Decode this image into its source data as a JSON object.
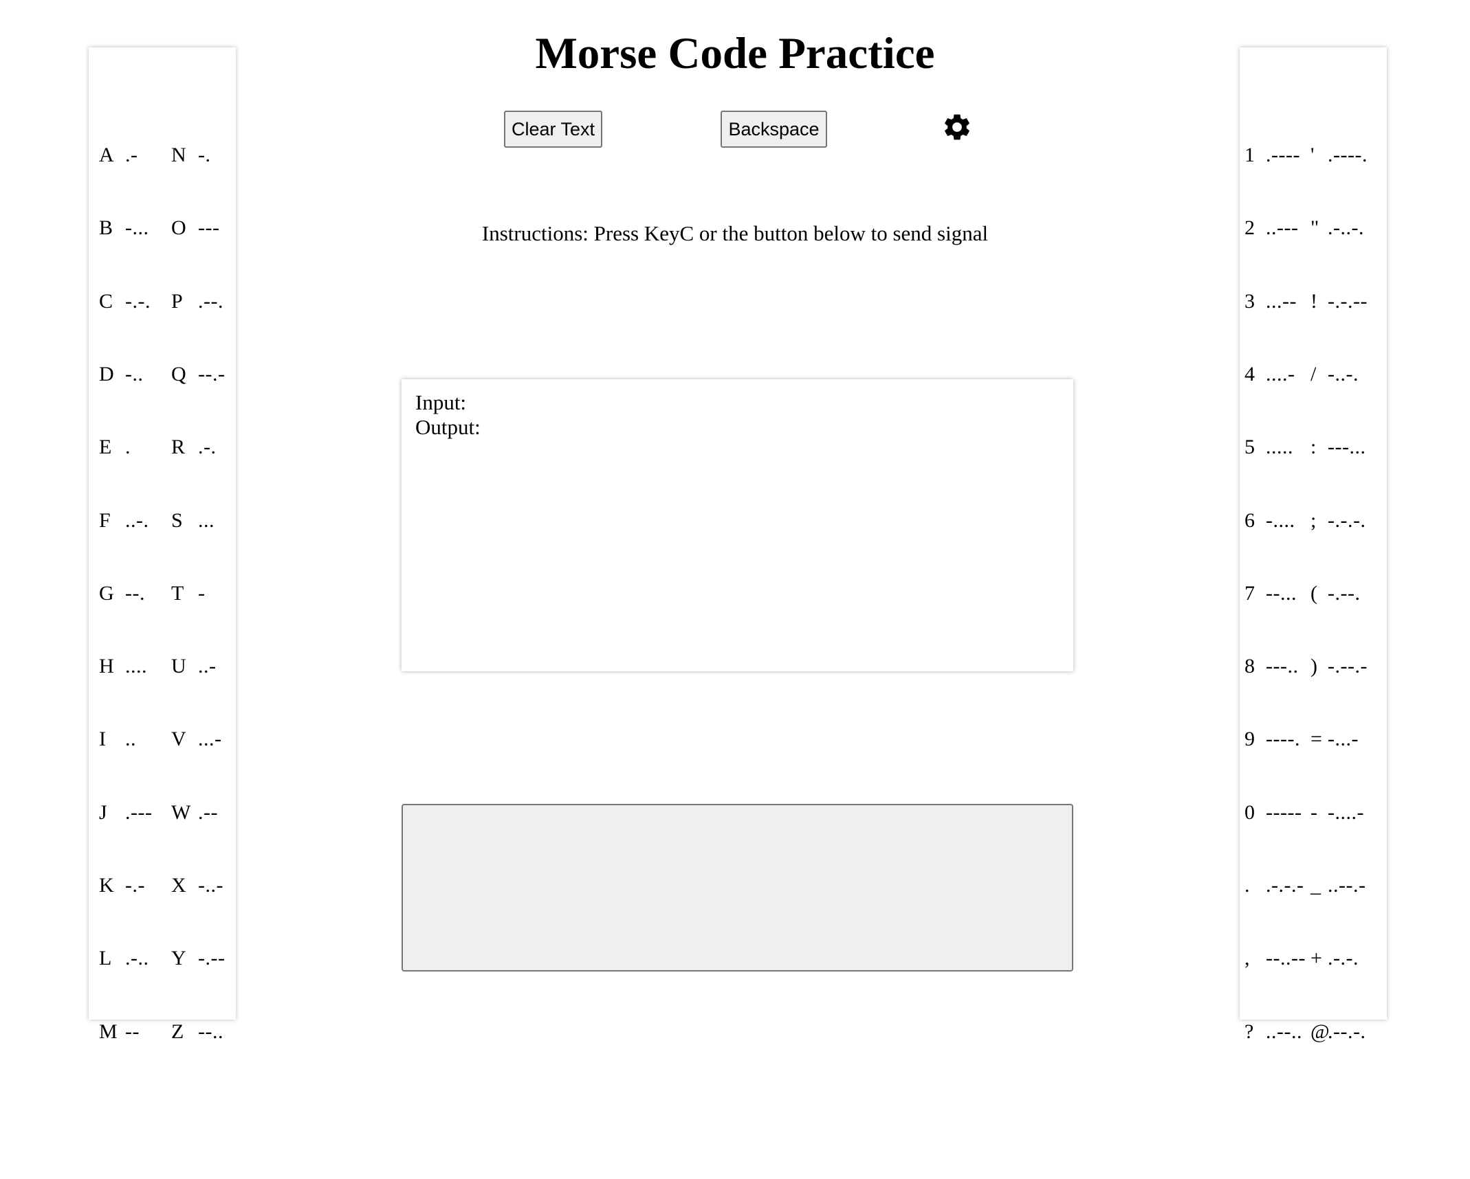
{
  "title": "Morse Code Practice",
  "toolbar": {
    "clear_label": "Clear Text",
    "backspace_label": "Backspace",
    "settings_icon": "gear-icon"
  },
  "instructions": "Instructions: Press KeyC or the button below to send signal",
  "output_box": {
    "input_label": "Input:",
    "input_value": "",
    "output_label": "Output:",
    "output_value": ""
  },
  "signal_button": {
    "label": ""
  },
  "left_table": [
    [
      [
        "A",
        ".-"
      ],
      [
        "N",
        "-."
      ]
    ],
    [
      [
        "B",
        "-..."
      ],
      [
        "O",
        "---"
      ]
    ],
    [
      [
        "C",
        "-.-."
      ],
      [
        "P",
        ".--."
      ]
    ],
    [
      [
        "D",
        "-.."
      ],
      [
        "Q",
        "--.-"
      ]
    ],
    [
      [
        "E",
        "."
      ],
      [
        "R",
        ".-."
      ]
    ],
    [
      [
        "F",
        "..-."
      ],
      [
        "S",
        "..."
      ]
    ],
    [
      [
        "G",
        "--."
      ],
      [
        "T",
        "-"
      ]
    ],
    [
      [
        "H",
        "...."
      ],
      [
        "U",
        "..-"
      ]
    ],
    [
      [
        "I",
        ".."
      ],
      [
        "V",
        "...-"
      ]
    ],
    [
      [
        "J",
        ".---"
      ],
      [
        "W",
        ".--"
      ]
    ],
    [
      [
        "K",
        "-.-"
      ],
      [
        "X",
        "-..-"
      ]
    ],
    [
      [
        "L",
        ".-.."
      ],
      [
        "Y",
        "-.--"
      ]
    ],
    [
      [
        "M",
        "--"
      ],
      [
        "Z",
        "--.."
      ]
    ]
  ],
  "right_table": [
    [
      [
        "1",
        ".----"
      ],
      [
        "'",
        ".----."
      ]
    ],
    [
      [
        "2",
        "..---"
      ],
      [
        "\"",
        ".-..-."
      ]
    ],
    [
      [
        "3",
        "...--"
      ],
      [
        "!",
        "-.-.--"
      ]
    ],
    [
      [
        "4",
        "....-"
      ],
      [
        "/",
        "-..-."
      ]
    ],
    [
      [
        "5",
        "....."
      ],
      [
        ":",
        "---..."
      ]
    ],
    [
      [
        "6",
        "-...."
      ],
      [
        ";",
        "-.-.-."
      ]
    ],
    [
      [
        "7",
        "--..."
      ],
      [
        "(",
        "-.--."
      ]
    ],
    [
      [
        "8",
        "---.."
      ],
      [
        ")",
        "-.--.-"
      ]
    ],
    [
      [
        "9",
        "----."
      ],
      [
        "=",
        "-...-"
      ]
    ],
    [
      [
        "0",
        "-----"
      ],
      [
        "-",
        "-....-"
      ]
    ],
    [
      [
        ".",
        ".-.-.-"
      ],
      [
        "_",
        "..--.-"
      ]
    ],
    [
      [
        ",",
        "--..--"
      ],
      [
        "+",
        ".-.-."
      ]
    ],
    [
      [
        "?",
        "..--.."
      ],
      [
        "@",
        ".--.-."
      ]
    ]
  ]
}
